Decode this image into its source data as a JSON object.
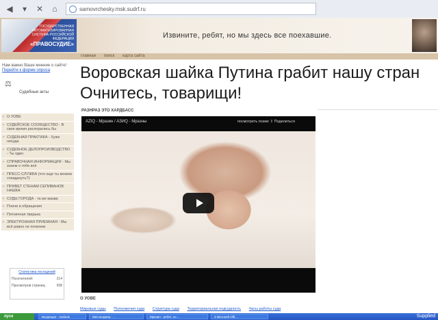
{
  "browser": {
    "url": "samovrchesky.msk.sudrf.ru"
  },
  "header": {
    "logo_caption": "ГОСУДАРСТВЕННАЯ АВТОМАТИЗИРОВАННАЯ СИСТЕМА РОССИЙСКОЙ ФЕДЕРАЦИИ",
    "logo_brand": "«ПРАВОСУДИЕ»",
    "banner_text": "Извините, ребят, но мы здесь все поехавшие."
  },
  "top_menu": [
    "главная",
    "поиск",
    "карта сайта"
  ],
  "sidebar": {
    "notice_text": "Нам важно Ваше мнение о сайте!",
    "notice_link": "Перейти к форме опроса",
    "acts_label": "Судебные акты",
    "menu": [
      "О УОВЕ",
      "СУДЕЙСКОЕ СООБЩЕСТВО - В свое время распорались бы",
      "СУДЕБНАЯ ПРАКТИКА - Хуже некуда",
      "СУДЕБНОЕ ДЕЛОПРОИЗВОДСТВО - Ты один",
      "СПРАВОЧНАЯ ИНФОРМАЦИЯ - Мы знаем о тебе всё",
      "ПРЕСС-СЛУЖБА (что еще ты можем спиздануть?)",
      "ПРИВЕТ СТЕНАМ СЕПИВАНОВ НАШКА",
      "СУДЫ ГОРОДА - та же мазва",
      "Плачи и обращения",
      "Пятничная тварька",
      "ЭЛЕКТРОННАЯ ПРИЕМНАЯ - Мы всё равно не починем"
    ],
    "stats": {
      "title": "Статистика посещений",
      "rows": [
        {
          "label": "Посетителей:",
          "value": "214"
        },
        {
          "label": "Просмотров страниц:",
          "value": "938"
        }
      ]
    }
  },
  "main": {
    "heading_line1": "Воровская шайка Путина грабит нашу стран",
    "heading_line2": "Очнитесь, товарищи!",
    "section_label": "РАЗНРАЗ ЭТО ХАРДБАСС",
    "video": {
      "title": "AZIQ - Мразин / АЗИQ - Мразны",
      "tools": "посмотреть позже  ⇪ Поделиться"
    },
    "about_label": "О УОВЕ",
    "footer_links": [
      "Мировые суды",
      "Полномочия суда",
      "Структура суда",
      "Территориальная подсудность",
      "Часы работы суда"
    ]
  },
  "taskbar": {
    "start": "пуск",
    "tasks": [
      "Входящие - Outlook",
      "Мессенджер - ...",
      "Мразин - ребят, но ...",
      "3 Microsoft Offi..."
    ],
    "credit": "Supplied"
  }
}
